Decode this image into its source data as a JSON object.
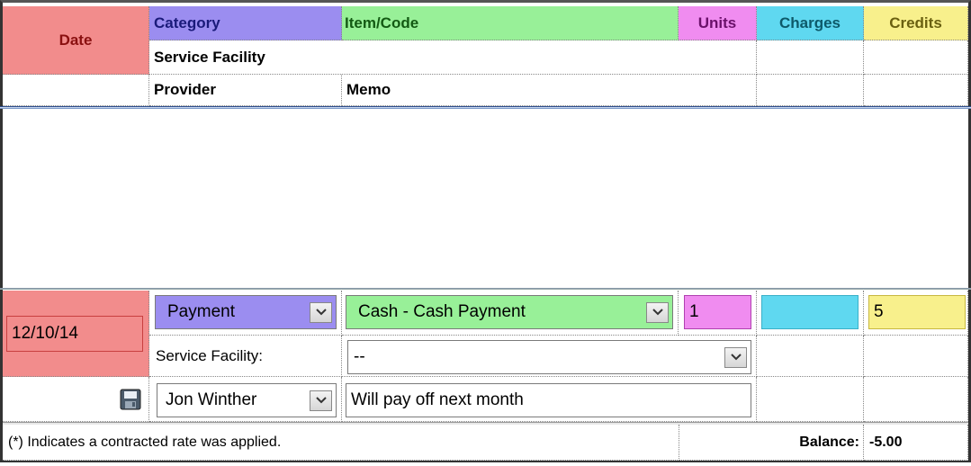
{
  "colors": {
    "date": "#f28c8c",
    "category": "#9b8df0",
    "item": "#98f098",
    "units": "#f08cf0",
    "charges": "#5fd8f0",
    "credits": "#f8f08c"
  },
  "header": {
    "date": "Date",
    "category": "Category",
    "item_code": "Item/Code",
    "units": "Units",
    "charges": "Charges",
    "credits": "Credits",
    "service_facility": "Service Facility",
    "provider": "Provider",
    "memo": "Memo"
  },
  "entry": {
    "date": "12/10/14",
    "category": "Payment",
    "item_code": "Cash - Cash Payment",
    "units": "1",
    "charges": "",
    "credits": "5",
    "service_facility_label": "Service Facility:",
    "service_facility": "--",
    "provider": "Jon Winther",
    "memo": "Will pay off next month",
    "save_icon": "floppy-disk-icon"
  },
  "footer": {
    "note": "(*) Indicates a contracted rate was applied.",
    "balance_label": "Balance:",
    "balance_value": "-5.00"
  }
}
